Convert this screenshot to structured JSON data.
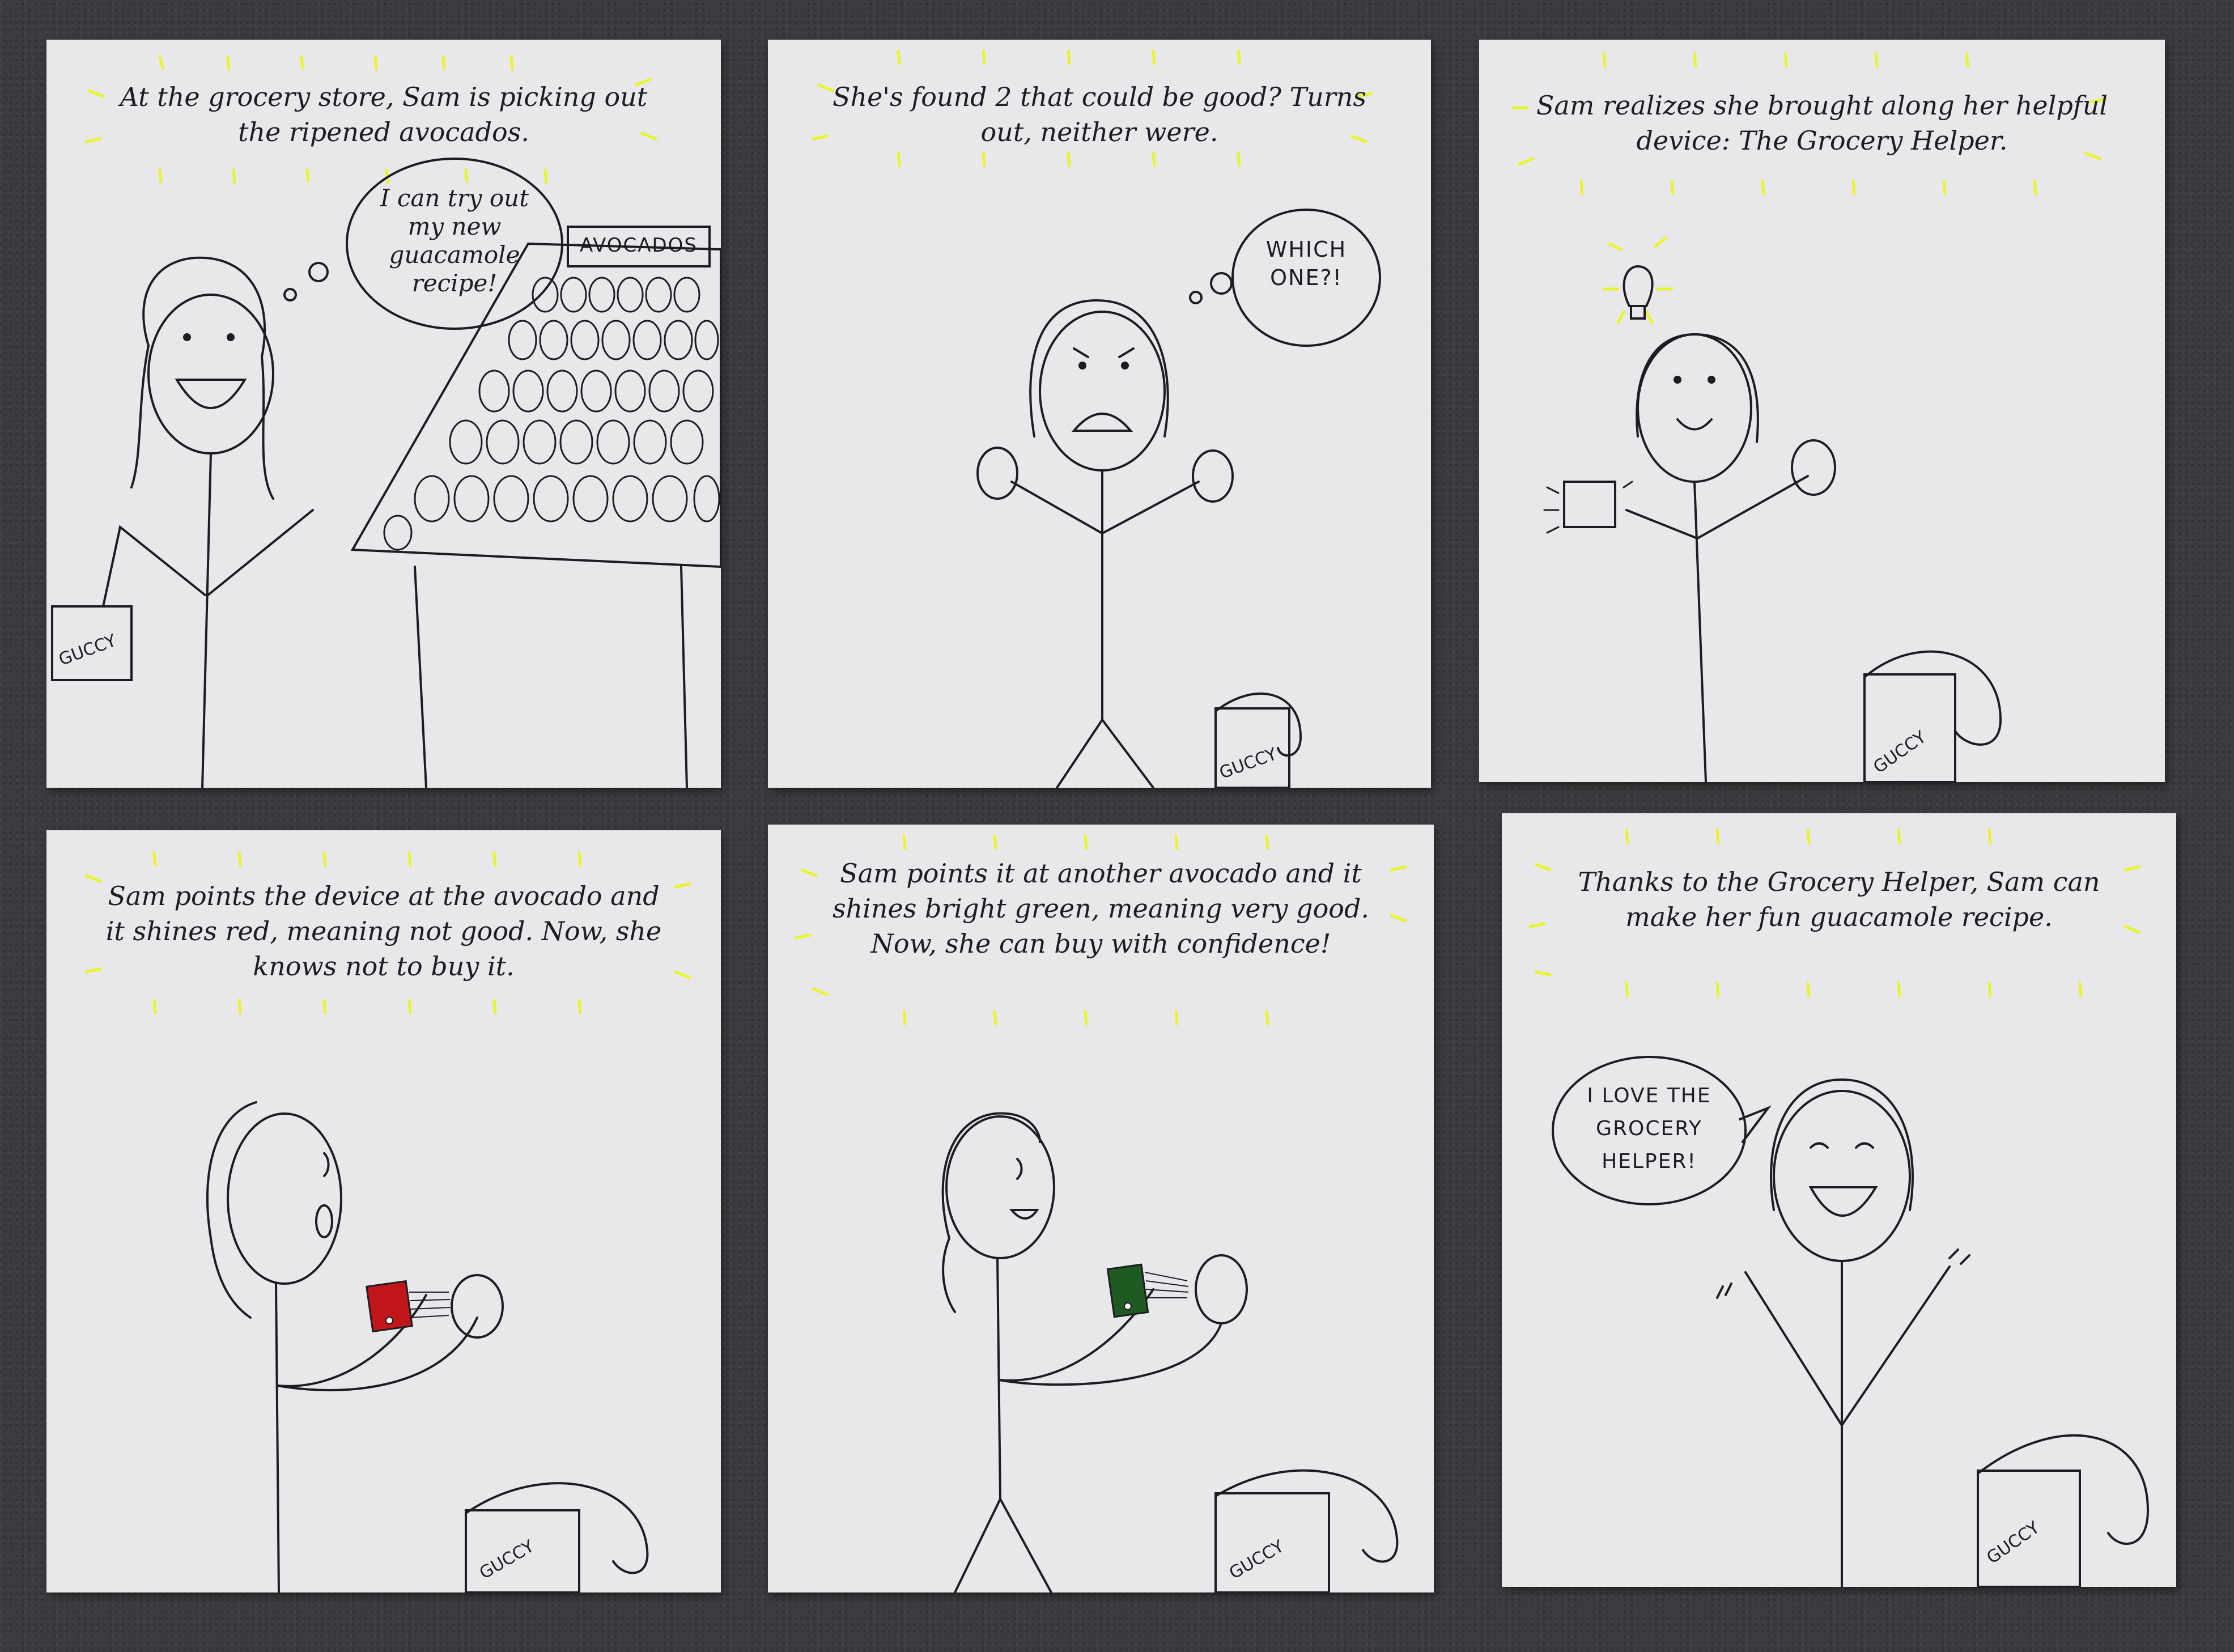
{
  "panels": [
    {
      "caption": "At the grocery store, Sam is picking out the ripened avocados.",
      "speech": "I can try out my new guacamole recipe!",
      "sign": "AVOCADOS",
      "bag_label": "GUCCY"
    },
    {
      "caption": "She's found 2 that could be good? Turns out, neither were.",
      "speech": "WHICH ONE?!",
      "bag_label": "GUCCY"
    },
    {
      "caption": "Sam realizes she brought along her helpful device: The Grocery Helper.",
      "bag_label": "GUCCY"
    },
    {
      "caption": "Sam points the device at the avocado and it shines red, meaning not good. Now, she knows not to buy it.",
      "bag_label": "GUCCY",
      "device_color": "#c0161a"
    },
    {
      "caption": "Sam points it at another avocado and it shines bright green, meaning very good. Now, she can buy with confidence!",
      "bag_label": "GUCCY",
      "device_color": "#1f5a22"
    },
    {
      "caption": "Thanks to the Grocery Helper, Sam can make her fun guacamole recipe.",
      "speech": "I LOVE THE GROCERY HELPER!",
      "bag_label": "GUCCY"
    }
  ],
  "colors": {
    "highlight": "#e8f52a",
    "ink": "#1c1c22",
    "paper": "#e8e7ea",
    "table": "#3b3c3f"
  }
}
